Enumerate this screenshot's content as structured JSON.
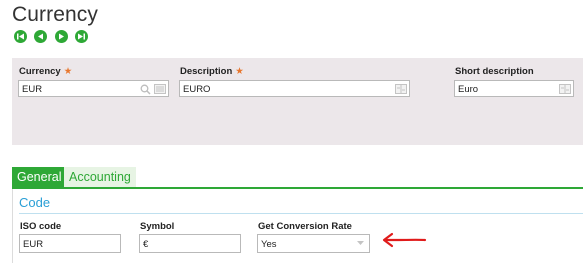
{
  "page": {
    "title": "Currency"
  },
  "nav": {
    "buttons": [
      {
        "name": "first-record-button",
        "icon": "skip-to-start-icon"
      },
      {
        "name": "previous-record-button",
        "icon": "previous-icon"
      },
      {
        "name": "next-record-button",
        "icon": "next-icon"
      },
      {
        "name": "last-record-button",
        "icon": "skip-to-end-icon"
      }
    ]
  },
  "header": {
    "currency": {
      "label": "Currency",
      "required_mark": "★",
      "value": "EUR",
      "icons": [
        "search-icon",
        "selection-list-icon"
      ]
    },
    "description": {
      "label": "Description",
      "required_mark": "★",
      "value": "EURO",
      "icons": [
        "translation-icon"
      ]
    },
    "short_description": {
      "label": "Short description",
      "value": "Euro",
      "icons": [
        "translation-icon"
      ]
    }
  },
  "tabs": [
    {
      "label": "General",
      "active": true
    },
    {
      "label": "Accounting",
      "active": false
    }
  ],
  "section": {
    "title": "Code",
    "iso_code": {
      "label": "ISO code",
      "value": "EUR"
    },
    "symbol": {
      "label": "Symbol",
      "value": "€"
    },
    "conversion_rate": {
      "label": "Get Conversion Rate",
      "selected": "Yes",
      "icon": "dropdown-arrow-icon"
    }
  },
  "annotation": {
    "icon": "red-arrow-icon",
    "color": "#e01b1b"
  },
  "colors": {
    "accent_green": "#2ea836",
    "section_blue": "#2a9fd6",
    "required_orange": "#e8772e",
    "header_bg": "#ece7ea"
  }
}
